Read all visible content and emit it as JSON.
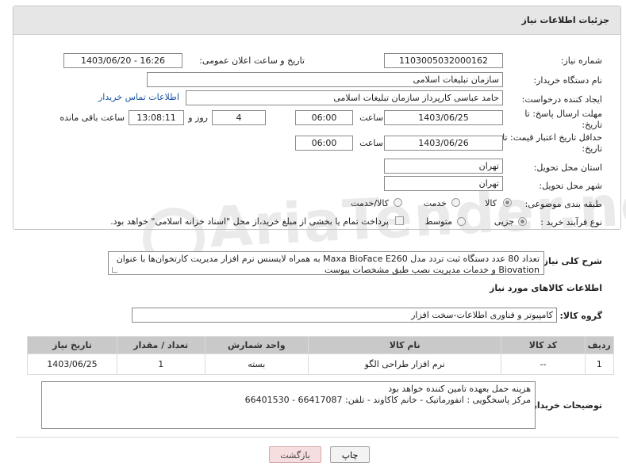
{
  "header": {
    "title": "جزئیات اطلاعات نیاز"
  },
  "fields": {
    "need_number_label": "شماره نیاز:",
    "need_number": "1103005032000162",
    "announce_label": "تاریخ و ساعت اعلان عمومی:",
    "announce_value": "1403/06/20 - 16:26",
    "buyer_org_label": "نام دستگاه خریدار:",
    "buyer_org": "سازمان تبلیغات اسلامی",
    "requester_label": "ایجاد کننده درخواست:",
    "requester": "حامد عباسی کارپرداز سازمان تبلیغات اسلامی",
    "contact_link": "اطلاعات تماس خریدار",
    "reply_deadline_label_1": "مهلت ارسال پاسخ: تا",
    "reply_deadline_label_2": "تاریخ:",
    "reply_date": "1403/06/25",
    "time_label": "ساعت",
    "reply_time": "06:00",
    "days_value": "4",
    "days_label": "روز و",
    "remaining_time": "13:08:11",
    "remaining_label": "ساعت باقی مانده",
    "price_validity_label_1": "حداقل تاریخ اعتبار قیمت: تا",
    "price_validity_label_2": "تاریخ:",
    "price_date": "1403/06/26",
    "price_time": "06:00",
    "province_label": "استان محل تحویل:",
    "province": "تهران",
    "city_label": "شهر محل تحویل:",
    "city": "تهران",
    "category_label": "طبقه بندی موضوعی:",
    "category_options": [
      "کالا",
      "خدمت",
      "کالا/خدمت"
    ],
    "process_label": "نوع فرآیند خرید :",
    "process_options": [
      "جزیی",
      "متوسط"
    ],
    "payment_note": "پرداخت تمام یا بخشی از مبلغ خرید،از محل \"اسناد خزانه اسلامی\" خواهد بود."
  },
  "description": {
    "label": "شرح کلی نیاز:",
    "text": "تعداد 80 عدد دستگاه ثبت تردد مدل Maxa BioFace E260 به همراه لایسنس نرم افزار مدیریت کارتخوان‌ها با عنوان Biovation و خدمات مدیریت نصب طبق مشخصات پیوست"
  },
  "goods_section": {
    "title": "اطلاعات کالاهای مورد نیاز",
    "group_label": "گروه کالا:",
    "group_value": "کامپیوتر و فناوری اطلاعات-سخت افزار"
  },
  "goods_table": {
    "headers": [
      "ردیف",
      "کد کالا",
      "نام کالا",
      "واحد شمارش",
      "تعداد / مقدار",
      "تاریخ نیاز"
    ],
    "rows": [
      [
        "1",
        "--",
        "نرم افزار طراحی الگو",
        "بسته",
        "1",
        "1403/06/25"
      ]
    ]
  },
  "buyer_notes": {
    "label": "توضیحات خریدار:",
    "line1": "هزینه حمل بعهده تامین کننده خواهد بود",
    "line2": "مرکز پاسخگویی : انفورماتیک - خانم کاکاوند - تلفن: 66417087 - 66401530"
  },
  "buttons": {
    "print": "چاپ",
    "back": "بازگشت"
  },
  "watermark": "AriaTender.neT"
}
